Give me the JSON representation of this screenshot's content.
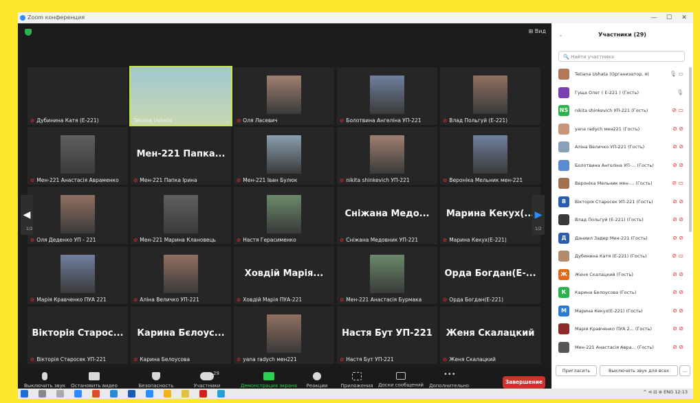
{
  "window": {
    "title": "Zoom конференция",
    "minimize": "—",
    "maximize": "☐",
    "close": "✕"
  },
  "view_button": "Вид",
  "tiles": [
    {
      "name": "Дубинина Катя (Е-221)",
      "photo": false
    },
    {
      "name": "Tetiana Ushata",
      "photo": true,
      "active": true
    },
    {
      "name": "Оля Ласевич",
      "photo": true
    },
    {
      "name": "Болотвина Ангеліна УП-221",
      "photo": true
    },
    {
      "name": "Влад Польгуй (Е-221)",
      "photo": true
    },
    {
      "name": "Мен-221 Анастасія Авраменко",
      "photo": true
    },
    {
      "name": "Мен-221 Папка Ірина",
      "big": "Мен-221 Папка..."
    },
    {
      "name": "Мен-221 Іван Булюк",
      "photo": true
    },
    {
      "name": "nikita shinkevich УП-221",
      "photo": true
    },
    {
      "name": "Вероніка Мельник мен-221",
      "photo": true
    },
    {
      "name": "Оля Деденко УП - 221",
      "photo": true
    },
    {
      "name": "Мен-221 Марина Клановець",
      "photo": true
    },
    {
      "name": "Настя Герасименко",
      "photo": true
    },
    {
      "name": "Сніжана Медовник УП-221",
      "big": "Сніжана Медо..."
    },
    {
      "name": "Марина Кекух(Е-221)",
      "big": "Марина Кекух(..."
    },
    {
      "name": "Марія Кравченко ПУА 221",
      "photo": true
    },
    {
      "name": "Аліна Величко УП-221",
      "photo": true
    },
    {
      "name": "Ховдій Марія ПУА-221",
      "big": "Ховдій Марія..."
    },
    {
      "name": "Мен-221 Анастасія Бурмака",
      "photo": true
    },
    {
      "name": "Орда Богдан(Е-221)",
      "big": "Орда Богдан(Е-..."
    },
    {
      "name": "Вікторія Старосек УП-221",
      "big": "Вікторія Старос..."
    },
    {
      "name": "Карина Белоусова",
      "big": "Карина Бєлоус..."
    },
    {
      "name": "yana radych мен221",
      "photo": true
    },
    {
      "name": "Настя Бут УП-221",
      "big": "Настя Бут УП-221"
    },
    {
      "name": "Женя Скалацкий",
      "big": "Женя Скалацкий"
    }
  ],
  "pagination": {
    "left": "1/2",
    "right": "1/2"
  },
  "toolbar": {
    "mute": "Выключить звук",
    "stop_video": "Остановить видео",
    "security": "Безопасность",
    "participants": "Участники",
    "participants_count": "29",
    "share": "Демонстрация экрана",
    "reactions": "Реакции",
    "apps": "Приложения",
    "whiteboard": "Доски сообщений",
    "more": "Дополнительно",
    "end": "Завершение"
  },
  "panel": {
    "title": "Участники (29)",
    "search_placeholder": "Найти участника",
    "participants": [
      {
        "name": "Tetiana Ushata (Организатор, я)",
        "avatar": "",
        "color": "#b07a5a",
        "icons": "🎙 ▭"
      },
      {
        "name": "Гуща Олег ( Е-221 ) (Гость)",
        "avatar": "",
        "color": "#7a3fb0",
        "icons": "🎙"
      },
      {
        "name": "nikita shinkevich УП-221 (Гость)",
        "avatar": "NS",
        "color": "#2bb24c",
        "icons": "⊘ ▭"
      },
      {
        "name": "yana radych мен221 (Гость)",
        "avatar": "",
        "color": "#c9957a",
        "icons": "⊘ ⊘"
      },
      {
        "name": "Аліна Величко УП-221 (Гость)",
        "avatar": "",
        "color": "#8aa0b8",
        "icons": "⊘ ⊘"
      },
      {
        "name": "Болотвина Ангеліна УП-... (Гость)",
        "avatar": "",
        "color": "#5a8ad0",
        "icons": "⊘ ⊘"
      },
      {
        "name": "Вероніка Мельник мен-... (Гость)",
        "avatar": "",
        "color": "#a07050",
        "icons": "⊘ ▭"
      },
      {
        "name": "Вікторія Старосек УП-221 (Гость)",
        "avatar": "B",
        "color": "#2a5db0",
        "icons": "⊘ ⊘"
      },
      {
        "name": "Влад Польгуй (Е-221) (Гость)",
        "avatar": "",
        "color": "#3a3a3a",
        "icons": "⊘ ⊘"
      },
      {
        "name": "Даниил Задер Мен-221 (Гость)",
        "avatar": "Д",
        "color": "#2a5db0",
        "icons": "⊘ ⊘"
      },
      {
        "name": "Дубинина Катя (Е-221) (Гость)",
        "avatar": "",
        "color": "#b08a6a",
        "icons": "⊘ ▭"
      },
      {
        "name": "Женя Скалацкий (Гость)",
        "avatar": "Ж",
        "color": "#e06a1a",
        "icons": "⊘ ⊘"
      },
      {
        "name": "Карина Белоусова (Гость)",
        "avatar": "К",
        "color": "#2bb24c",
        "icons": "⊘ ⊘"
      },
      {
        "name": "Марина Кекух(Е-221) (Гость)",
        "avatar": "M",
        "color": "#2a7ad0",
        "icons": "⊘ ⊘"
      },
      {
        "name": "Марія Кравченко ПУА 2... (Гость)",
        "avatar": "",
        "color": "#8a2a2a",
        "icons": "⊘ ⊘"
      },
      {
        "name": "Мен-221 Анастасія Авра... (Гость)",
        "avatar": "",
        "color": "#555555",
        "icons": "⊘ ⊘"
      }
    ],
    "invite": "Пригласить",
    "mute_all": "Выключить звук для всех",
    "more": "..."
  },
  "taskbar": {
    "lang": "ENG",
    "time": "12:13",
    "tray": "^ ⊲ ⊡ ⊛"
  }
}
